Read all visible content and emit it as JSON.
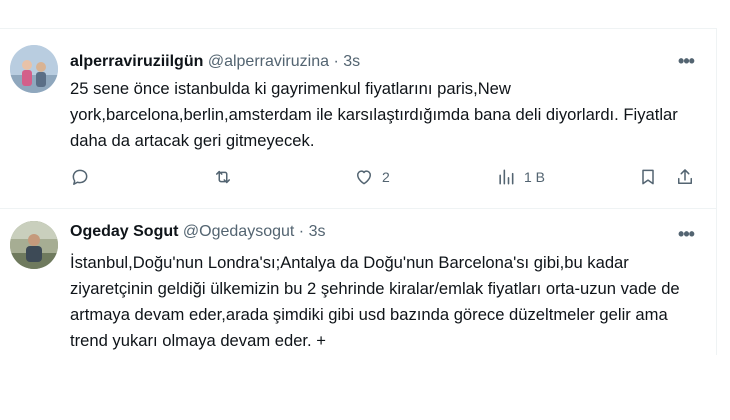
{
  "tweets": [
    {
      "display_name": "alperraviruziilgün",
      "handle": "@alperraviruzina",
      "separator": "·",
      "time": "3s",
      "text": "25 sene önce istanbulda ki gayrimenkul fiyatlarını paris,New york,barcelona,berlin,amsterdam ile karsılaştırdığımda bana deli diyorlardı. Fiyatlar daha da artacak geri gitmeyecek.",
      "more": "•••",
      "actions": {
        "reply_icon": "reply-icon",
        "retweet_icon": "retweet-icon",
        "like_icon": "heart-icon",
        "like_count": "2",
        "views_icon": "views-icon",
        "views_count": "1 B",
        "bookmark_icon": "bookmark-icon",
        "share_icon": "share-icon"
      }
    },
    {
      "display_name": "Ogeday Sogut",
      "handle": "@Ogedaysogut",
      "separator": "·",
      "time": "3s",
      "text": "İstanbul,Doğu'nun Londra'sı;Antalya da Doğu'nun Barcelona'sı gibi,bu kadar ziyaretçinin geldiği ülkemizin bu 2 şehrinde kiralar/emlak fiyatları orta-uzun vade de artmaya devam eder,arada şimdiki gibi usd bazında görece düzeltmeler gelir ama trend yukarı olmaya devam eder. +",
      "more": "•••"
    }
  ],
  "colors": {
    "text": "#0f1419",
    "secondary": "#536471",
    "border": "#eff3f4"
  }
}
